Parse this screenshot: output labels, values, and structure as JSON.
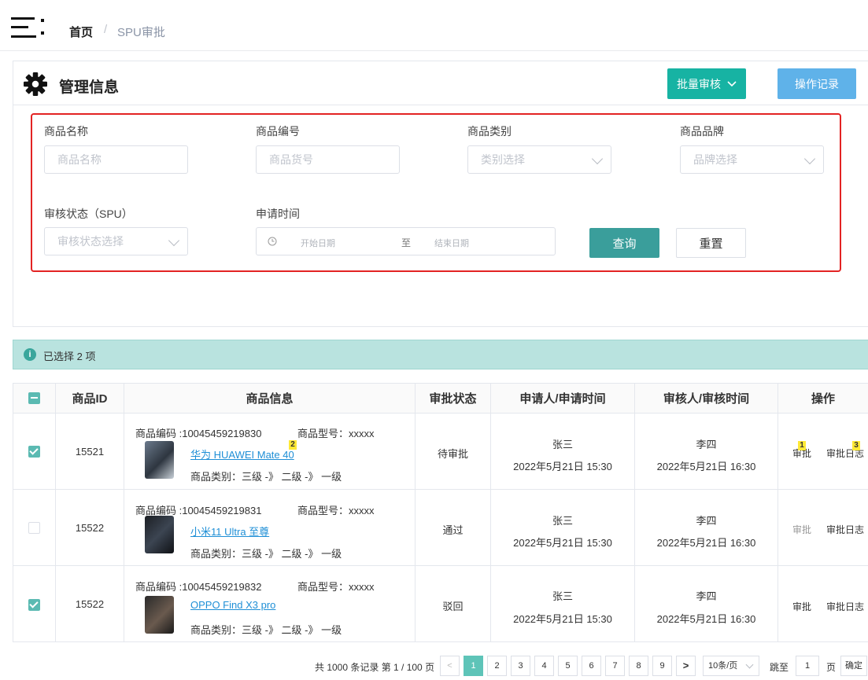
{
  "breadcrumb": {
    "home": "首页",
    "separator": "/",
    "current": "SPU审批"
  },
  "panel": {
    "title": "管理信息",
    "batch_label": "批量审核",
    "log_label": "操作记录"
  },
  "filters": {
    "name_label": "商品名称",
    "name_placeholder": "商品名称",
    "code_label": "商品编号",
    "code_placeholder": "商品货号",
    "category_label": "商品类别",
    "category_placeholder": "类别选择",
    "brand_label": "商品品牌",
    "brand_placeholder": "品牌选择",
    "status_label": "审核状态（SPU）",
    "status_placeholder": "审核状态选择",
    "time_label": "申请时间",
    "start_placeholder": "开始日期",
    "range_sep": "至",
    "end_placeholder": "结束日期",
    "query_label": "查询",
    "reset_label": "重置"
  },
  "selection": {
    "icon": "i",
    "text": "已选择 2 项"
  },
  "table": {
    "headers": [
      "商品ID",
      "商品信息",
      "审批状态",
      "申请人/申请时间",
      "审核人/审核时间",
      "操作"
    ],
    "rows": [
      {
        "checked": true,
        "id": "15521",
        "code": "商品编码 :10045459219830",
        "model": "商品型号：xxxxx",
        "name": "华为 HUAWEI Mate 40",
        "category": "商品类别：三级 -》 二级 -》 一级",
        "status": "待审批",
        "applicant": "张三",
        "apply_time": "2022年5月21日 15:30",
        "reviewer": "李四",
        "review_time": "2022年5月21日 16:30",
        "op1": "审批",
        "op2": "审批日志",
        "op1_dim": false
      },
      {
        "checked": false,
        "id": "15522",
        "code": "商品编码 :10045459219831",
        "model": "商品型号：xxxxx",
        "name": "小米11 Ultra 至尊",
        "category": "商品类别：三级 -》 二级 -》 一级",
        "status": "通过",
        "applicant": "张三",
        "apply_time": "2022年5月21日 15:30",
        "reviewer": "李四",
        "review_time": "2022年5月21日 16:30",
        "op1": "审批",
        "op2": "审批日志",
        "op1_dim": true
      },
      {
        "checked": true,
        "id": "15522",
        "code": "商品编码 :10045459219832",
        "model": "商品型号：xxxxx",
        "name": "OPPO Find X3 pro",
        "category": "商品类别：三级 -》 二级 -》 一级",
        "status": "驳回",
        "applicant": "张三",
        "apply_time": "2022年5月21日 15:30",
        "reviewer": "李四",
        "review_time": "2022年5月21日 16:30",
        "op1": "审批",
        "op2": "审批日志",
        "op1_dim": false
      }
    ],
    "badges": [
      "2",
      "1",
      "3"
    ]
  },
  "pagination": {
    "total": "共 1000 条记录 第 1 / 100 页",
    "prev": "<",
    "next": ">",
    "pages": [
      "1",
      "2",
      "3",
      "4",
      "5",
      "6",
      "7",
      "8",
      "9"
    ],
    "current_page": "1",
    "page_size": "10条/页",
    "jump_label": "跳至",
    "jump_value": "1",
    "page_unit": "页",
    "confirm_label": "确定"
  },
  "colors": {
    "accent": "#17b3a3",
    "log_button": "#5fb2e9",
    "query_button": "#3a9e9b",
    "highlight_box": "#e32323",
    "link": "#1f8fd6"
  }
}
